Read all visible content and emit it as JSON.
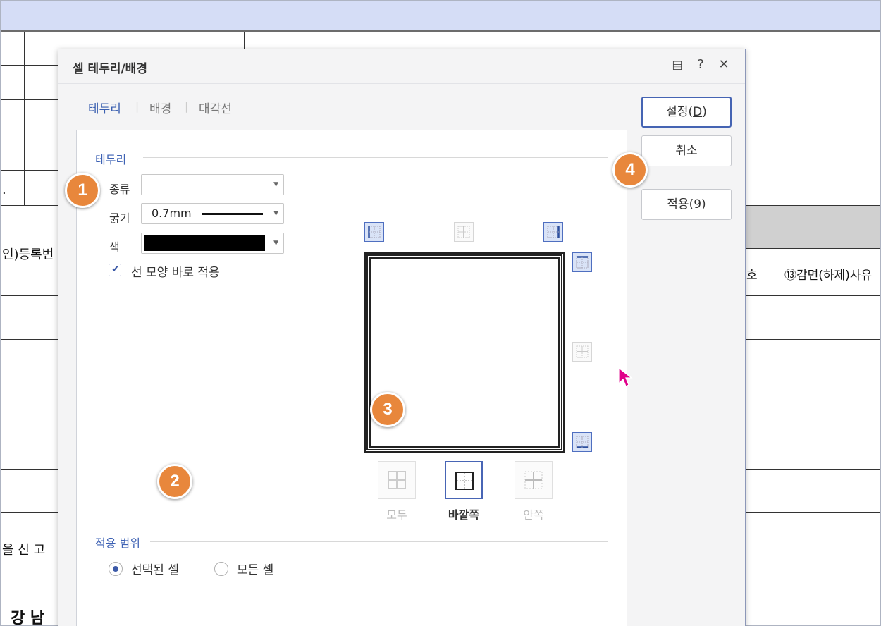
{
  "document": {
    "left_fragment_1": "인)등록번",
    "left_fragment_2": "을  신 고",
    "left_fragment_3": "강 남 ",
    "left_fragment_4": ".",
    "right_col_1": "호",
    "right_col_2": "⑬감면(하제)사유"
  },
  "dialog": {
    "title": "셀 테두리/배경",
    "controls": {
      "comment": "▤",
      "help": "?",
      "close": "✕"
    },
    "tabs": [
      "테두리",
      "배경",
      "대각선"
    ],
    "active_tab": "테두리",
    "border_section": {
      "title": "테두리",
      "type_label": "종류",
      "thickness_label": "굵기",
      "thickness_value": "0.7mm",
      "color_label": "색",
      "color_value": "#000000",
      "apply_immediately_label": "선 모양 바로 적용",
      "apply_immediately_checked": true
    },
    "presets": [
      {
        "label": "모두",
        "selected": false
      },
      {
        "label": "바깥쪽",
        "selected": true
      },
      {
        "label": "안쪽",
        "selected": false
      }
    ],
    "scope_section": {
      "title": "적용 범위",
      "options": [
        {
          "label": "선택된 셀",
          "checked": true
        },
        {
          "label": "모든 셀",
          "checked": false
        }
      ]
    },
    "buttons": {
      "ok_text": "설정(",
      "ok_key": "D",
      "cancel": "취소",
      "apply_text": "적용(",
      "apply_key": "9",
      "close_paren": ")"
    }
  },
  "badges": [
    "1",
    "2",
    "3",
    "4"
  ],
  "colors": {
    "accent": "#3e62b4",
    "badge": "#e8873c",
    "cursor": "#e0008a",
    "doc_header": "#d5ddf6"
  }
}
